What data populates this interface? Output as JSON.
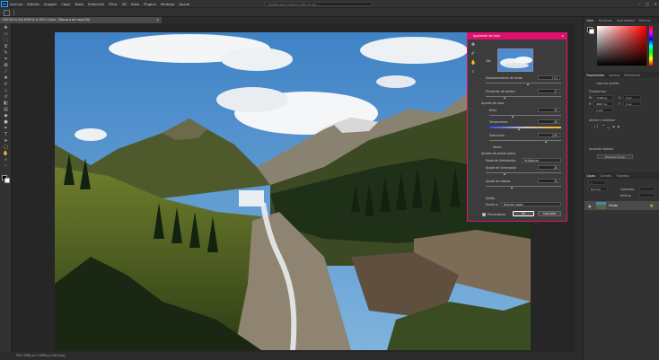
{
  "menubar": {
    "logo": "Ps",
    "items": [
      "Archivo",
      "Edición",
      "Imagen",
      "Capa",
      "Texto",
      "Selección",
      "Filtro",
      "3D",
      "Vista",
      "Plugins",
      "Ventana",
      "Ayuda"
    ],
    "hint": "Arrastre para mover la capa de calc..."
  },
  "document": {
    "tab_title": "DSC3414-3/4-HDR.tif al 50% (Color, Máscara de capa/16)",
    "status": "50%   3286 px x 2698 px (240 ppp)"
  },
  "panels": {
    "color_tabs": [
      "Color",
      "Muestras",
      "Degradados",
      "Motivos"
    ],
    "props_tabs": [
      "Propiedades",
      "Ajustes",
      "Bibliotecas"
    ],
    "layer_kind": "Capa de píxeles",
    "transform": "Transformar",
    "w": "7768 px",
    "h": "4867 px",
    "x": "0 px",
    "y": "0 px",
    "angle": "0,00°",
    "align": "Alinear y distribuir",
    "quick_actions": "Acciones rápidas",
    "quick_btn_1": "Eliminar fondo",
    "layers_tabs": [
      "Capas",
      "Canales",
      "Trazados"
    ],
    "layer_name": "Fondo",
    "blend_mode": "Normal",
    "opacity": "Opacidad",
    "fill": "Relleno"
  },
  "dialog": {
    "title": "Igualación de color",
    "objective_label": "Obj.",
    "edge_shift_label": "Desplazamiento de borde",
    "edge_shift": "+11",
    "edge_transition_label": "Transición de bordes",
    "edge_transition": "27",
    "color_settings": "Ajustes de color",
    "brightness_label": "Brillo",
    "brightness": "32",
    "temperature_label": "Temperatura",
    "temperature": "-36",
    "saturation_label": "Saturación",
    "saturation": "100",
    "volume_label": "Volver",
    "foreground_settings": "Ajustes de primer plano",
    "lighting_mode_label": "Modo de iluminación:",
    "lighting_mode": "Multiplicar",
    "lighting_adjust_label": "Ajuste de iluminación",
    "lighting_adjust": "26",
    "color_adjust_label": "Ajuste de colores",
    "color_adjust": "35",
    "output_label": "Salida",
    "send_to_label": "Enviar a:",
    "send_to": "Nuevas capas",
    "preview_label": "Previsualizar",
    "ok": "OK",
    "cancel": "Cancelar"
  }
}
